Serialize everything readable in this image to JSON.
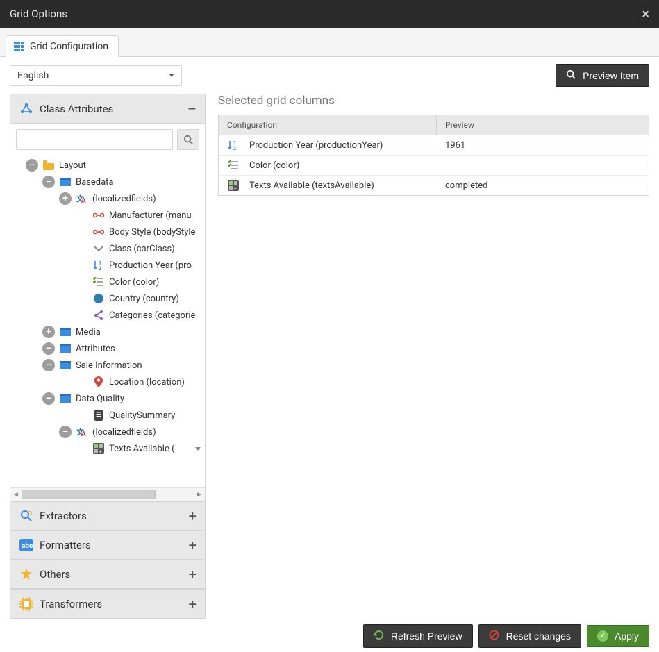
{
  "window": {
    "title": "Grid Options",
    "close_label": "×"
  },
  "tabs": {
    "active": {
      "label": "Grid Configuration"
    }
  },
  "language_select": {
    "value": "English"
  },
  "toolbar": {
    "preview_item": "Preview Item"
  },
  "accordions": {
    "class_attributes": {
      "label": "Class Attributes",
      "expanded": true
    },
    "extractors": {
      "label": "Extractors",
      "expanded": false
    },
    "formatters": {
      "label": "Formatters",
      "expanded": false
    },
    "others": {
      "label": "Others",
      "expanded": false
    },
    "transformers": {
      "label": "Transformers",
      "expanded": false
    }
  },
  "search": {
    "placeholder": ""
  },
  "tree": {
    "root": {
      "label": "Layout"
    },
    "basedata": {
      "label": "Basedata"
    },
    "localizedfields1": {
      "label": "(localizedfields)"
    },
    "manufacturer": {
      "label": "Manufacturer (manu"
    },
    "body_style": {
      "label": "Body Style (bodyStyle"
    },
    "carclass": {
      "label": "Class (carClass)"
    },
    "production_year": {
      "label": "Production Year (pro"
    },
    "color": {
      "label": "Color (color)"
    },
    "country": {
      "label": "Country (country)"
    },
    "categories": {
      "label": "Categories (categorie"
    },
    "media": {
      "label": "Media"
    },
    "attributes": {
      "label": "Attributes"
    },
    "sale_info": {
      "label": "Sale Information"
    },
    "location": {
      "label": "Location (location)"
    },
    "data_quality": {
      "label": "Data Quality"
    },
    "quality_summary": {
      "label": "QualitySummary"
    },
    "localizedfields2": {
      "label": "(localizedfields)"
    },
    "texts_available": {
      "label": "Texts Available ("
    }
  },
  "right": {
    "heading": "Selected grid columns",
    "columns": {
      "configuration": "Configuration",
      "preview": "Preview"
    },
    "rows": [
      {
        "config_label": "Production Year (productionYear)",
        "preview": "1961",
        "icon": "sort-numeric"
      },
      {
        "config_label": "Color (color)",
        "preview": "",
        "icon": "multiselect"
      },
      {
        "config_label": "Texts Available (textsAvailable)",
        "preview": "completed",
        "icon": "calculated"
      }
    ]
  },
  "footer": {
    "refresh": "Refresh Preview",
    "reset": "Reset changes",
    "apply": "Apply"
  },
  "colors": {
    "accent_blue": "#3c8dde",
    "green": "#4a8a2c",
    "panel_bg": "#e8e8e8"
  }
}
